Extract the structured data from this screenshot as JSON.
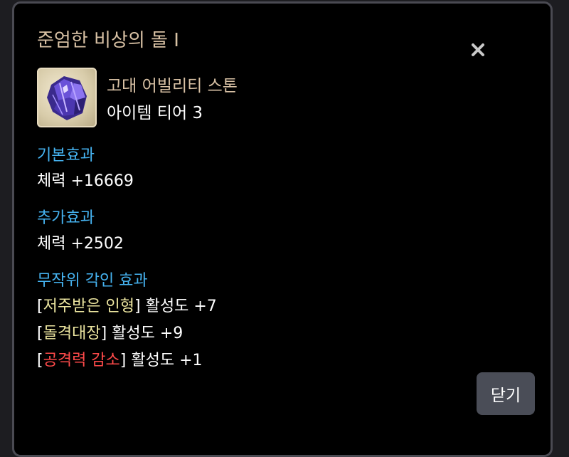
{
  "dialog": {
    "title": "준엄한 비상의 돌 I",
    "close_icon": "close-icon",
    "close_button_label": "닫기"
  },
  "item": {
    "icon": "ability-stone-icon",
    "name": "고대 어빌리티 스톤",
    "tier": "아이템 티어 3"
  },
  "basic_effect": {
    "heading": "기본효과",
    "stat_label": "체력",
    "stat_value": "+16669"
  },
  "additional_effect": {
    "heading": "추가효과",
    "stat_label": "체력",
    "stat_value": "+2502"
  },
  "random_engraving": {
    "heading": "무작위 각인 효과",
    "activity_label": "활성도",
    "entries": [
      {
        "name": "저주받은 인형",
        "value": "+7",
        "color": "#ede6a0"
      },
      {
        "name": "돌격대장",
        "value": "+9",
        "color": "#ede6a0"
      },
      {
        "name": "공격력 감소",
        "value": "+1",
        "color": "#ff4a4a"
      }
    ]
  },
  "colors": {
    "title": "#d8c1a4",
    "section_heading": "#46b4f2",
    "text": "#ffffff",
    "positive_engraving": "#ede6a0",
    "negative_engraving": "#ff4a4a",
    "button_bg": "#4a4d57"
  }
}
